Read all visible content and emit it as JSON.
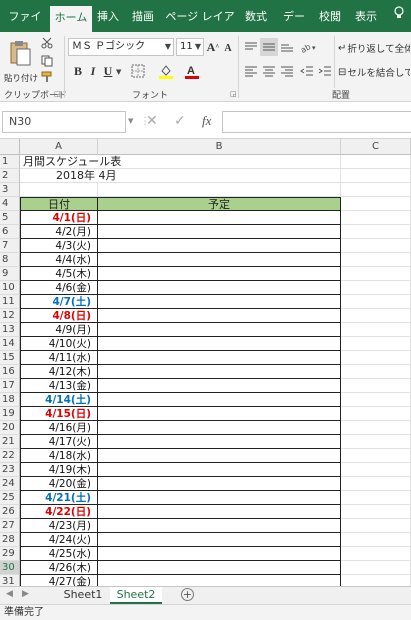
{
  "ribbon_tabs": [
    "ファイル",
    "ホーム",
    "挿入",
    "描画",
    "ページ レイアウト",
    "数式",
    "データ",
    "校閲",
    "表示"
  ],
  "active_tab": "ホーム",
  "ribbon": {
    "paste_label": "貼り付け",
    "font_name": "ＭＳ Ｐゴシック",
    "font_size": "11",
    "wrap_text": "折り返して全体を",
    "merge_center": "セルを結合して中",
    "groups": {
      "clipboard": "クリップボード",
      "font": "フォント",
      "alignment": "配置"
    }
  },
  "formula_bar": {
    "name_box": "N30",
    "fx": "fx",
    "formula": ""
  },
  "columns": [
    "A",
    "B",
    "C"
  ],
  "sheet": {
    "title": "月間スケジュール表",
    "month": "2018年 4月",
    "header_date": "日付",
    "header_plan": "予定",
    "rows": [
      {
        "n": "1",
        "a": "",
        "kind": "title"
      },
      {
        "n": "2",
        "a": "",
        "kind": "month"
      },
      {
        "n": "3",
        "a": "",
        "kind": "blank"
      },
      {
        "n": "4",
        "a": "",
        "kind": "header"
      },
      {
        "n": "5",
        "a": "4/1(日)",
        "kind": "sun"
      },
      {
        "n": "6",
        "a": "4/2(月)",
        "kind": "wd"
      },
      {
        "n": "7",
        "a": "4/3(火)",
        "kind": "wd"
      },
      {
        "n": "8",
        "a": "4/4(水)",
        "kind": "wd"
      },
      {
        "n": "9",
        "a": "4/5(木)",
        "kind": "wd"
      },
      {
        "n": "10",
        "a": "4/6(金)",
        "kind": "wd"
      },
      {
        "n": "11",
        "a": "4/7(土)",
        "kind": "sat"
      },
      {
        "n": "12",
        "a": "4/8(日)",
        "kind": "sun"
      },
      {
        "n": "13",
        "a": "4/9(月)",
        "kind": "wd"
      },
      {
        "n": "14",
        "a": "4/10(火)",
        "kind": "wd"
      },
      {
        "n": "15",
        "a": "4/11(水)",
        "kind": "wd"
      },
      {
        "n": "16",
        "a": "4/12(木)",
        "kind": "wd"
      },
      {
        "n": "17",
        "a": "4/13(金)",
        "kind": "wd"
      },
      {
        "n": "18",
        "a": "4/14(土)",
        "kind": "sat"
      },
      {
        "n": "19",
        "a": "4/15(日)",
        "kind": "sun"
      },
      {
        "n": "20",
        "a": "4/16(月)",
        "kind": "wd"
      },
      {
        "n": "21",
        "a": "4/17(火)",
        "kind": "wd"
      },
      {
        "n": "22",
        "a": "4/18(水)",
        "kind": "wd"
      },
      {
        "n": "23",
        "a": "4/19(木)",
        "kind": "wd"
      },
      {
        "n": "24",
        "a": "4/20(金)",
        "kind": "wd"
      },
      {
        "n": "25",
        "a": "4/21(土)",
        "kind": "sat"
      },
      {
        "n": "26",
        "a": "4/22(日)",
        "kind": "sun"
      },
      {
        "n": "27",
        "a": "4/23(月)",
        "kind": "wd"
      },
      {
        "n": "28",
        "a": "4/24(火)",
        "kind": "wd"
      },
      {
        "n": "29",
        "a": "4/25(水)",
        "kind": "wd"
      },
      {
        "n": "30",
        "a": "4/26(木)",
        "kind": "wd"
      },
      {
        "n": "31",
        "a": "4/27(金)",
        "kind": "wd"
      }
    ]
  },
  "sheet_tabs": [
    "Sheet1",
    "Sheet2"
  ],
  "active_sheet": "Sheet2",
  "status_text": "準備完了",
  "colors": {
    "excel_green": "#217346",
    "header_fill": "#a9d08e",
    "sunday": "#e00000",
    "saturday": "#0070c0"
  }
}
